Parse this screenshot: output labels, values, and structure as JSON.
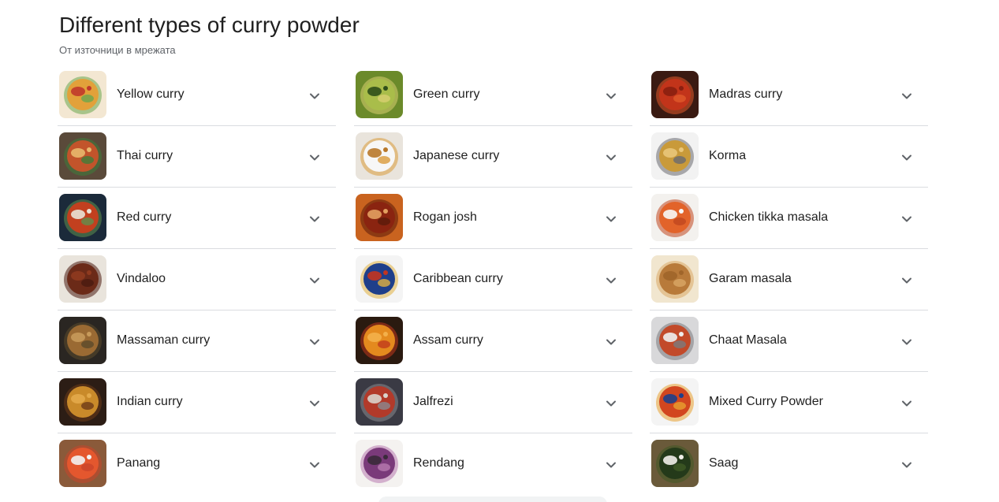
{
  "header": {
    "title": "Different types of curry powder",
    "subtitle": "От източници в мрежата"
  },
  "columns": [
    {
      "items": [
        {
          "label": "Yellow curry",
          "icon": "yellow-curry-image",
          "colors": [
            "#f3e7d2",
            "#e2a13a",
            "#c0392b",
            "#6aa84f"
          ]
        },
        {
          "label": "Thai curry",
          "icon": "thai-curry-image",
          "colors": [
            "#5a4a3a",
            "#c2542b",
            "#e8b86d",
            "#3e7d3a"
          ]
        },
        {
          "label": "Red curry",
          "icon": "red-curry-image",
          "colors": [
            "#1b2a3a",
            "#c2401f",
            "#e9e2d5",
            "#5f8f4e"
          ]
        },
        {
          "label": "Vindaloo",
          "icon": "vindaloo-image",
          "colors": [
            "#e9e4dc",
            "#6b2a18",
            "#8f3a1f",
            "#4a1a10"
          ]
        },
        {
          "label": "Massaman curry",
          "icon": "massaman-curry-image",
          "colors": [
            "#2a2622",
            "#9a6a33",
            "#c79a5a",
            "#5b4a2b"
          ]
        },
        {
          "label": "Indian curry",
          "icon": "indian-curry-image",
          "colors": [
            "#2c1d15",
            "#c98a2a",
            "#e3a94a",
            "#6e3a18"
          ]
        },
        {
          "label": "Panang",
          "icon": "panang-image",
          "colors": [
            "#8a5a3a",
            "#e4572e",
            "#f2f2f2",
            "#c9452a"
          ]
        }
      ]
    },
    {
      "items": [
        {
          "label": "Green curry",
          "icon": "green-curry-image",
          "colors": [
            "#6b8a2a",
            "#a9bd4a",
            "#2f4f1a",
            "#d8d070"
          ]
        },
        {
          "label": "Japanese curry",
          "icon": "japanese-curry-image",
          "colors": [
            "#e9e4dc",
            "#f7f7f7",
            "#b8782a",
            "#d99a3a"
          ]
        },
        {
          "label": "Rogan josh",
          "icon": "rogan-josh-image",
          "colors": [
            "#c9631f",
            "#8a2410",
            "#e2a060",
            "#5a1a0a"
          ]
        },
        {
          "label": "Caribbean curry",
          "icon": "caribbean-curry-image",
          "colors": [
            "#f4f4f4",
            "#1f3f8a",
            "#c2341f",
            "#e0b040"
          ]
        },
        {
          "label": "Assam curry",
          "icon": "assam-curry-image",
          "colors": [
            "#2a1a10",
            "#e48a1e",
            "#f3b04a",
            "#c0391b"
          ]
        },
        {
          "label": "Jalfrezi",
          "icon": "jalfrezi-image",
          "colors": [
            "#3a3a44",
            "#b23a2a",
            "#d9d4cc",
            "#8a8a90"
          ]
        },
        {
          "label": "Rendang",
          "icon": "rendang-image",
          "colors": [
            "#f4f2f0",
            "#7a3a7a",
            "#3a2a3a",
            "#b87ab0"
          ]
        }
      ]
    },
    {
      "items": [
        {
          "label": "Madras curry",
          "icon": "madras-curry-image",
          "colors": [
            "#3a1a12",
            "#c2341a",
            "#8a1f10",
            "#e05a2a"
          ]
        },
        {
          "label": "Korma",
          "icon": "korma-image",
          "colors": [
            "#f2f2f2",
            "#c99a3a",
            "#e9c67a",
            "#6a6a70"
          ]
        },
        {
          "label": "Chicken tikka masala",
          "icon": "chicken-tikka-masala-image",
          "colors": [
            "#f3f1ee",
            "#e2632a",
            "#f7f7f7",
            "#c0461f"
          ]
        },
        {
          "label": "Garam masala",
          "icon": "garam-masala-image",
          "colors": [
            "#f1e6cf",
            "#b87a3a",
            "#a0652a",
            "#d9a866"
          ]
        },
        {
          "label": "Chaat Masala",
          "icon": "chaat-masala-image",
          "colors": [
            "#d8d8da",
            "#c24a2a",
            "#eeeeee",
            "#7a7a7e"
          ]
        },
        {
          "label": "Mixed Curry Powder",
          "icon": "mixed-curry-powder-image",
          "colors": [
            "#f4f4f4",
            "#d2461f",
            "#1f3f8a",
            "#e8a030"
          ]
        },
        {
          "label": "Saag",
          "icon": "saag-image",
          "colors": [
            "#6a5a3a",
            "#243a1a",
            "#f2f0ea",
            "#3f5a24"
          ]
        }
      ]
    }
  ],
  "chevron_icon": "chevron-down-icon",
  "chevron_color": "#5f6368",
  "divider_color": "#dadce0"
}
